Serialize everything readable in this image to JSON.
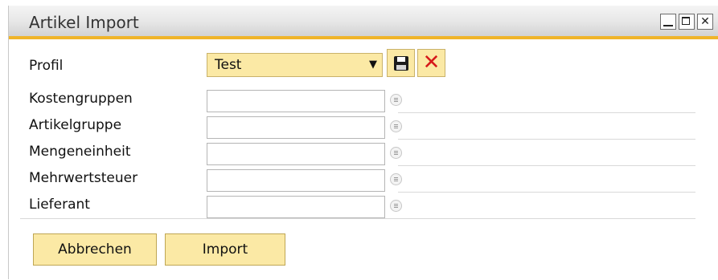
{
  "window": {
    "title": "Artikel Import",
    "minimize": "minimize",
    "maximize": "maximize",
    "close": "close"
  },
  "profile": {
    "label": "Profil",
    "value": "Test",
    "save_icon": "floppy-disk-icon",
    "delete_icon": "red-x-icon"
  },
  "fields": [
    {
      "label": "Kostengruppen",
      "value": ""
    },
    {
      "label": "Artikelgruppe",
      "value": ""
    },
    {
      "label": "Mengeneinheit",
      "value": ""
    },
    {
      "label": "Mehrwertsteuer",
      "value": ""
    },
    {
      "label": "Lieferant",
      "value": ""
    }
  ],
  "buttons": {
    "cancel": "Abbrechen",
    "import": "Import"
  },
  "colors": {
    "accent": "#f0b429",
    "button_bg": "#fbe9a5",
    "delete_red": "#d6191a"
  }
}
